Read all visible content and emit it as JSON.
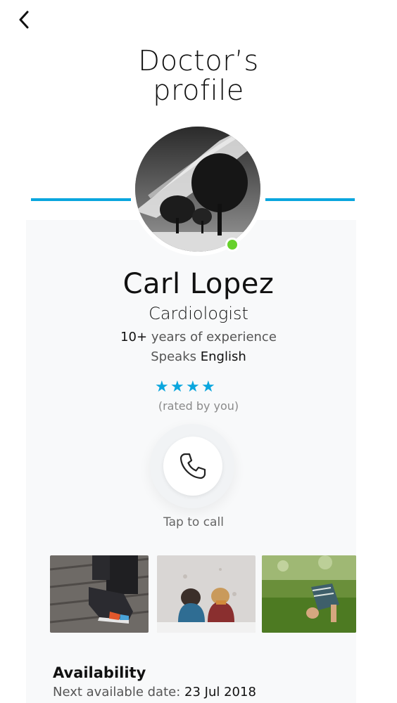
{
  "header": {
    "title_line1": "Doctor’s",
    "title_line2": "profile"
  },
  "doctor": {
    "name": "Carl Lopez",
    "specialty": "Cardiologist",
    "experience_value": "10+",
    "experience_text": "years of experience",
    "languages_label": "Speaks",
    "languages_value": "English",
    "rating_stars": 4,
    "rating_note": "(rated by you)",
    "online_status_color": "#67d12b"
  },
  "call": {
    "label": "Tap to call"
  },
  "availability": {
    "title": "Availability",
    "next_label": "Next available date:",
    "next_date": "23 Jul 2018"
  },
  "theme": {
    "accent": "#0aa6de",
    "card_bg": "#f8f9fa"
  },
  "icons": {
    "back": "back-chevron-icon",
    "call": "phone-icon",
    "star": "star-icon"
  }
}
